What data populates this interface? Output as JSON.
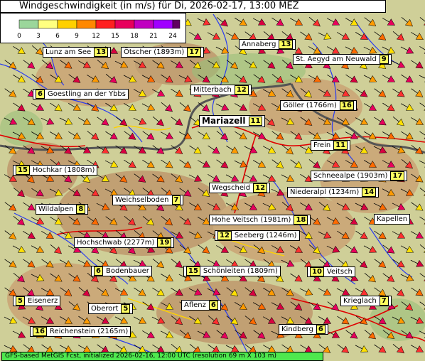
{
  "title": "Windgeschwindigkeit (in m/s) für Di, 2026-02-17, 13:00 MEZ",
  "legend": {
    "ticks": [
      "0",
      "3",
      "6",
      "9",
      "12",
      "15",
      "18",
      "21",
      "24"
    ],
    "colors": [
      "#9bd69b",
      "#ffff80",
      "#ffd000",
      "#ff8800",
      "#ff2020",
      "#e8005c",
      "#c000c0",
      "#a000ff",
      "#600060"
    ]
  },
  "places": [
    {
      "name": "Lunz am See",
      "value": "13"
    },
    {
      "name": "Ötscher (1893m)",
      "value": "17"
    },
    {
      "name": "Annaberg",
      "value": "13"
    },
    {
      "name": "St. Aegyd am Neuwald",
      "value": "9"
    },
    {
      "name": "Goestling an der Ybbs",
      "value": "6"
    },
    {
      "name": "Mitterbach",
      "value": "12"
    },
    {
      "name": "Göller (1766m)",
      "value": "16"
    },
    {
      "name": "Mariazell",
      "value": "11"
    },
    {
      "name": "Frein",
      "value": "11"
    },
    {
      "name": "Hochkar (1808m)",
      "value": "15"
    },
    {
      "name": "Schneealpe (1903m)",
      "value": "17"
    },
    {
      "name": "Wegscheid",
      "value": "12"
    },
    {
      "name": "Niederalpl (1234m)",
      "value": "14"
    },
    {
      "name": "Weichselboden",
      "value": "7"
    },
    {
      "name": "Wildalpen",
      "value": "8"
    },
    {
      "name": "Hohe Veitsch (1981m)",
      "value": "18"
    },
    {
      "name": "Kapellen",
      "value": ""
    },
    {
      "name": "Seeberg (1246m)",
      "value": "12"
    },
    {
      "name": "Hochschwab (2277m)",
      "value": "19"
    },
    {
      "name": "Bodenbauer",
      "value": "6"
    },
    {
      "name": "Schönleiten (1809m)",
      "value": "15"
    },
    {
      "name": "Veitsch",
      "value": "10"
    },
    {
      "name": "Eisenerz",
      "value": "5"
    },
    {
      "name": "Oberort",
      "value": "5"
    },
    {
      "name": "Aflenz",
      "value": "6"
    },
    {
      "name": "Krieglach",
      "value": "7"
    },
    {
      "name": "Reichenstein (2165m)",
      "value": "16"
    },
    {
      "name": "Kindberg",
      "value": "6"
    }
  ],
  "footer": "GFS-based MetGIS Fcst, initialized 2026-02-16, 12:00 UTC  (resolution 69 m X 103 m)"
}
